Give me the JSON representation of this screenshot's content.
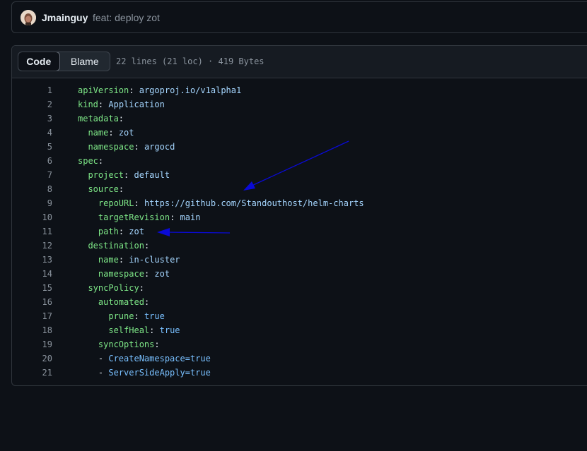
{
  "commit": {
    "author": "Jmainguy",
    "message": "feat: deploy zot"
  },
  "file": {
    "tabs": [
      {
        "label": "Code",
        "selected": true
      },
      {
        "label": "Blame",
        "selected": false
      }
    ],
    "info": "22 lines (21 loc) · 419 Bytes"
  },
  "code_lines": [
    {
      "n": "1",
      "indent": 0,
      "key": "apiVersion",
      "value": "argoproj.io/v1alpha1"
    },
    {
      "n": "2",
      "indent": 0,
      "key": "kind",
      "value": "Application"
    },
    {
      "n": "3",
      "indent": 0,
      "key": "metadata",
      "value": ""
    },
    {
      "n": "4",
      "indent": 1,
      "key": "name",
      "value": "zot"
    },
    {
      "n": "5",
      "indent": 1,
      "key": "namespace",
      "value": "argocd"
    },
    {
      "n": "6",
      "indent": 0,
      "key": "spec",
      "value": ""
    },
    {
      "n": "7",
      "indent": 1,
      "key": "project",
      "value": "default"
    },
    {
      "n": "8",
      "indent": 1,
      "key": "source",
      "value": ""
    },
    {
      "n": "9",
      "indent": 2,
      "key": "repoURL",
      "value": "https://github.com/Standouthost/helm-charts"
    },
    {
      "n": "10",
      "indent": 2,
      "key": "targetRevision",
      "value": "main"
    },
    {
      "n": "11",
      "indent": 2,
      "key": "path",
      "value": "zot"
    },
    {
      "n": "12",
      "indent": 1,
      "key": "destination",
      "value": ""
    },
    {
      "n": "13",
      "indent": 2,
      "key": "name",
      "value": "in-cluster"
    },
    {
      "n": "14",
      "indent": 2,
      "key": "namespace",
      "value": "zot"
    },
    {
      "n": "15",
      "indent": 1,
      "key": "syncPolicy",
      "value": ""
    },
    {
      "n": "16",
      "indent": 2,
      "key": "automated",
      "value": ""
    },
    {
      "n": "17",
      "indent": 3,
      "key": "prune",
      "value": "true",
      "bool": true
    },
    {
      "n": "18",
      "indent": 3,
      "key": "selfHeal",
      "value": "true",
      "bool": true
    },
    {
      "n": "19",
      "indent": 2,
      "key": "syncOptions",
      "value": ""
    },
    {
      "n": "20",
      "indent": 2,
      "item": "CreateNamespace=true"
    },
    {
      "n": "21",
      "indent": 2,
      "item": "ServerSideApply=true"
    }
  ],
  "annotations": {
    "color": "#0a0ad6",
    "arrows": [
      "arrow-to-source-line",
      "arrow-to-path-line"
    ]
  }
}
